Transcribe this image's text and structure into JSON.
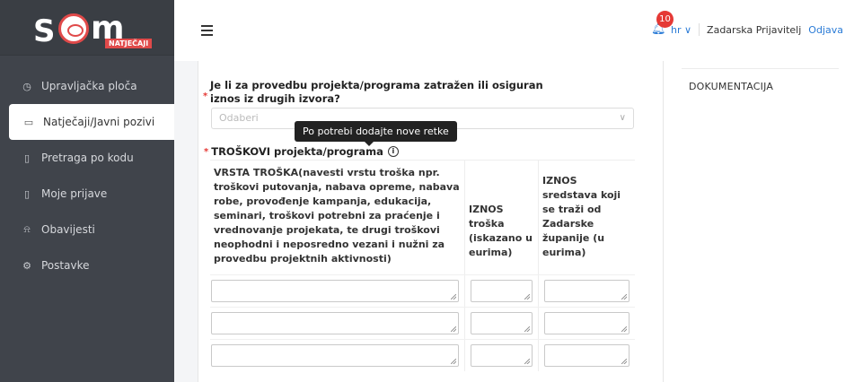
{
  "sidebar": {
    "logo": {
      "text_s": "S",
      "text_m": "m",
      "subtitle": "NATJEČAJI"
    },
    "items": [
      {
        "label": "Upravljačka ploča",
        "icon": "dashboard-icon"
      },
      {
        "label": "Natječaji/Javni pozivi",
        "icon": "folder-icon",
        "active": true
      },
      {
        "label": "Pretraga po kodu",
        "icon": "document-icon"
      },
      {
        "label": "Moje prijave",
        "icon": "file-edit-icon"
      },
      {
        "label": "Obavijesti",
        "icon": "bell-icon"
      },
      {
        "label": "Postavke",
        "icon": "gear-icon"
      }
    ]
  },
  "header": {
    "notification_count": "10",
    "language": "hr ∨",
    "username": "Zadarska Prijavitelj",
    "logout": "Odjava"
  },
  "form": {
    "question": "Je li za provedbu projekta/programa zatražen ili osiguran iznos iz drugih izvora?",
    "select_placeholder": "Odaberi",
    "tooltip": "Po potrebi dodajte nove retke",
    "costs_label": "TROŠKOVI projekta/programa",
    "table": {
      "headers": [
        "VRSTA TROŠKA(navesti vrstu troška npr. troškovi putovanja, nabava opreme, nabava robe, provođenje kampanja, edukacija, seminari, troškovi potrebni za praćenje i vrednovanje projekata, te drugi troškovi neophodni i neposredno vezani i nužni za provedbu projektnih aktivnosti)",
        "IZNOS troška (iskazano u eurima)",
        "IZNOS sredstava koji se traži od Zadarske županije (u eurima)"
      ],
      "rows": 3
    }
  },
  "side_panel": {
    "link": "DOKUMENTACIJA"
  },
  "colors": {
    "sidebar_bg": "#40444b",
    "accent": "#2a7bd6",
    "required": "#e53935",
    "badge": "#e53935"
  }
}
